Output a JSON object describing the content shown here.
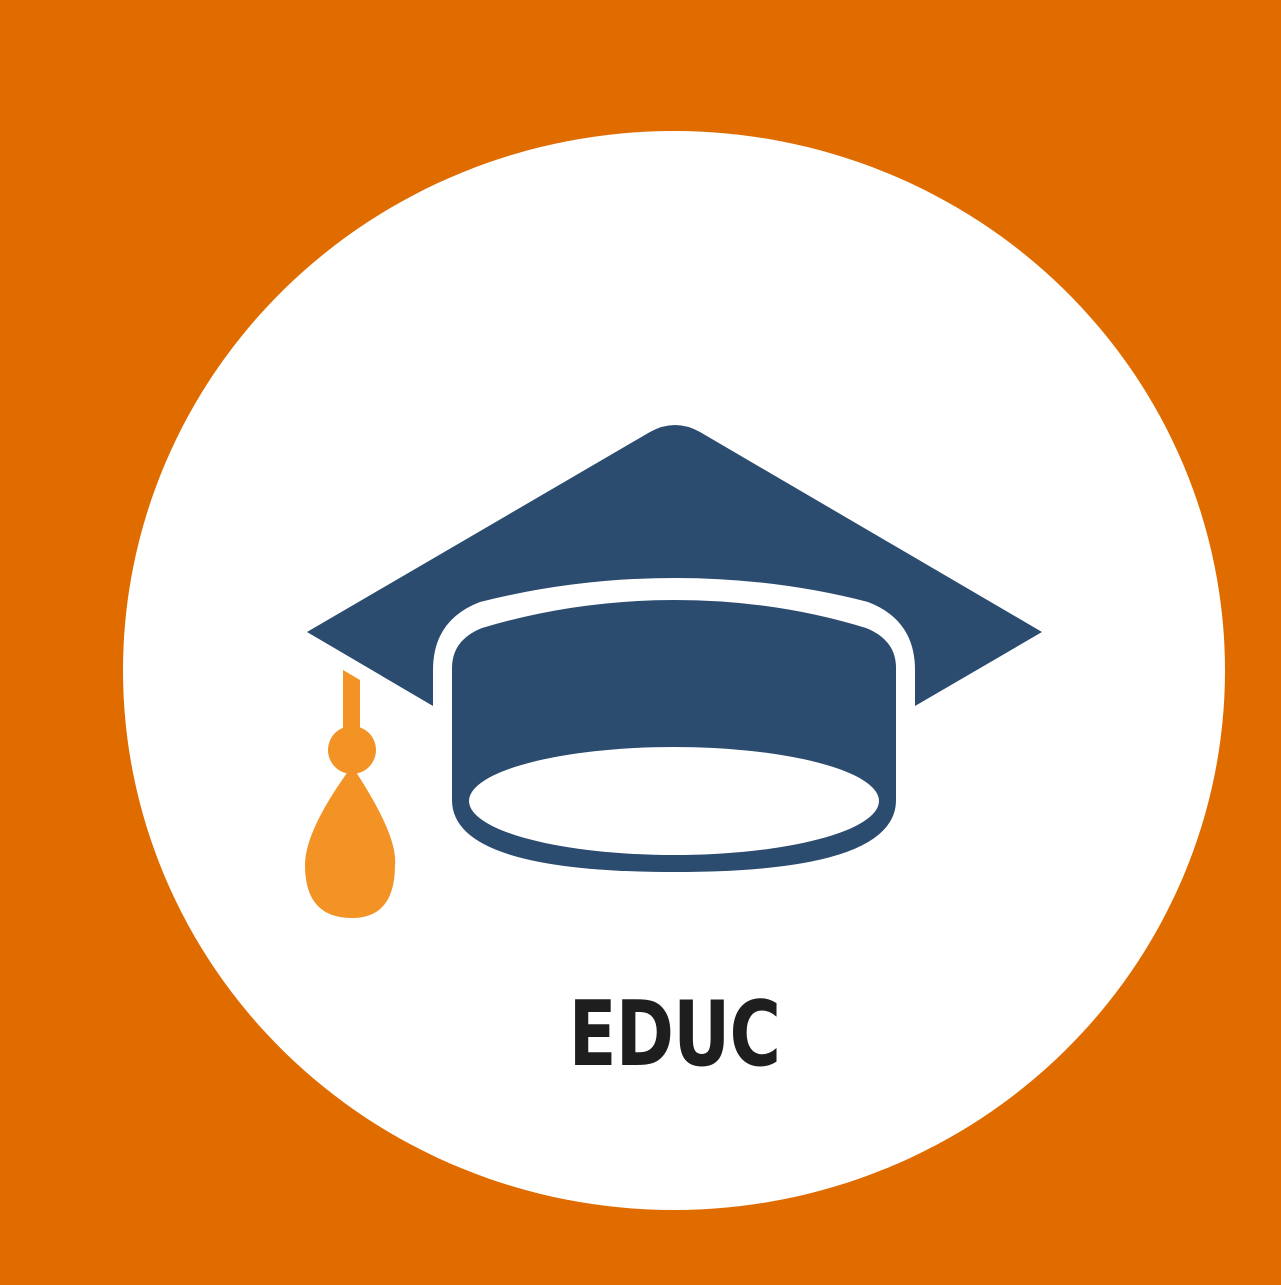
{
  "logo": {
    "label": "EDUC",
    "icon": "graduation-cap-icon",
    "colors": {
      "background": "#E06C00",
      "badge": "#FFFFFF",
      "cap": "#2B4B6F",
      "tassel": "#F39325",
      "text": "#1E1E1E"
    }
  }
}
